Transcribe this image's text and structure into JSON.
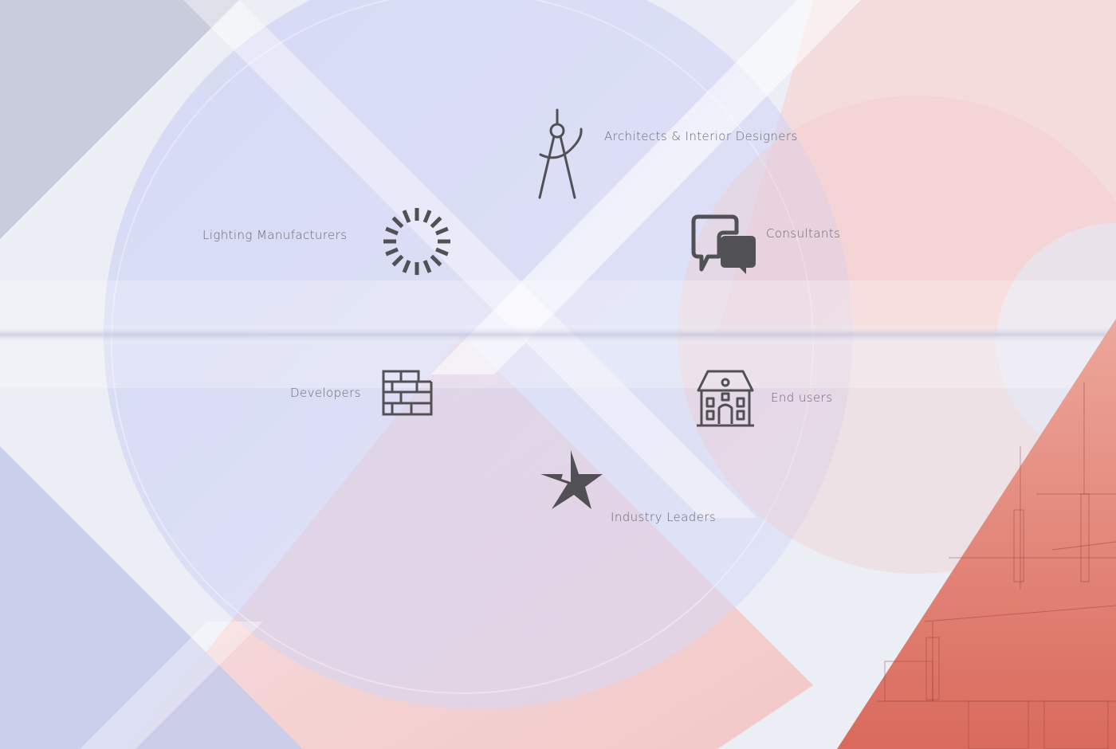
{
  "stakeholders": {
    "architects": {
      "label": "Architects & Interior Designers",
      "icon": "compass-icon"
    },
    "lighting": {
      "label": "Lighting Manufacturers",
      "icon": "loading-spinner-icon"
    },
    "consultants": {
      "label": "Consultants",
      "icon": "chat-bubbles-icon"
    },
    "developers": {
      "label": "Developers",
      "icon": "brick-wall-icon"
    },
    "end_users": {
      "label": "End users",
      "icon": "house-icon"
    },
    "industry": {
      "label": "Industry Leaders",
      "icon": "star-icon"
    }
  },
  "colors": {
    "icon": "#505055",
    "text": "#6a6a70",
    "blue_tint": "#c9cdf2",
    "pink_tint": "#f6cfcf",
    "coral": "#e07a6c"
  }
}
